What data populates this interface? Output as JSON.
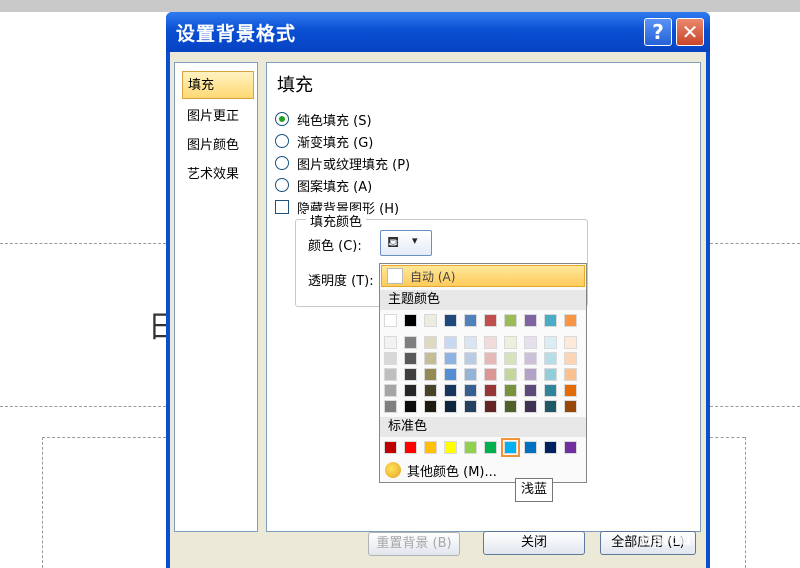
{
  "dialog": {
    "title": "设置背景格式",
    "help_label": "?",
    "close_label": "✕"
  },
  "sidebar": {
    "items": [
      {
        "label": "填充"
      },
      {
        "label": "图片更正"
      },
      {
        "label": "图片颜色"
      },
      {
        "label": "艺术效果"
      }
    ]
  },
  "fill": {
    "heading": "填充",
    "options": [
      {
        "label": "纯色填充 (S)",
        "type": "radio",
        "checked": true
      },
      {
        "label": "渐变填充 (G)",
        "type": "radio",
        "checked": false
      },
      {
        "label": "图片或纹理填充 (P)",
        "type": "radio",
        "checked": false
      },
      {
        "label": "图案填充 (A)",
        "type": "radio",
        "checked": false
      },
      {
        "label": "隐藏背景图形 (H)",
        "type": "checkbox",
        "checked": false
      }
    ],
    "group_title": "填充颜色",
    "color_label": "颜色 (C):",
    "transparency_label": "透明度 (T):",
    "dropdown_arrow": "▾"
  },
  "color_menu": {
    "auto_label": "自动 (A)",
    "theme_title": "主题颜色",
    "standard_title": "标准色",
    "more_label": "其他颜色 (M)...",
    "tooltip": "浅蓝",
    "theme_top": [
      "#ffffff",
      "#000000",
      "#eeece1",
      "#1f497d",
      "#4f81bd",
      "#c0504d",
      "#9bbb59",
      "#8064a2",
      "#4bacc6",
      "#f79646"
    ],
    "theme_shades": [
      [
        "#f2f2f2",
        "#7f7f7f",
        "#ddd9c3",
        "#c6d9f0",
        "#dbe5f1",
        "#f2dcdb",
        "#ebf1dd",
        "#e5e0ec",
        "#dbeef3",
        "#fdeada"
      ],
      [
        "#d8d8d8",
        "#595959",
        "#c4bd97",
        "#8db3e2",
        "#b8cce4",
        "#e5b9b7",
        "#d7e3bc",
        "#ccc1d9",
        "#b7dde8",
        "#fbd5b5"
      ],
      [
        "#bfbfbf",
        "#3f3f3f",
        "#938953",
        "#548dd4",
        "#95b3d7",
        "#d99694",
        "#c3d69b",
        "#b2a2c7",
        "#92cddc",
        "#fac08f"
      ],
      [
        "#a5a5a5",
        "#262626",
        "#494429",
        "#17365d",
        "#366092",
        "#953734",
        "#76923c",
        "#5f497a",
        "#31859b",
        "#e36c09"
      ],
      [
        "#7f7f7f",
        "#0c0c0c",
        "#1d1b10",
        "#0f243e",
        "#244061",
        "#632423",
        "#4f6128",
        "#3f3151",
        "#205867",
        "#974806"
      ]
    ],
    "standard": [
      "#c00000",
      "#ff0000",
      "#ffc000",
      "#ffff00",
      "#92d050",
      "#00b050",
      "#00b0f0",
      "#0070c0",
      "#002060",
      "#7030a0"
    ],
    "selected_standard_index": 6
  },
  "buttons": {
    "reset_label": "重置背景 (B)",
    "close_label": "关闭",
    "apply_all_label": "全部应用 (L)"
  },
  "background": {
    "slide_text": "日",
    "watermark": "Baidu"
  }
}
